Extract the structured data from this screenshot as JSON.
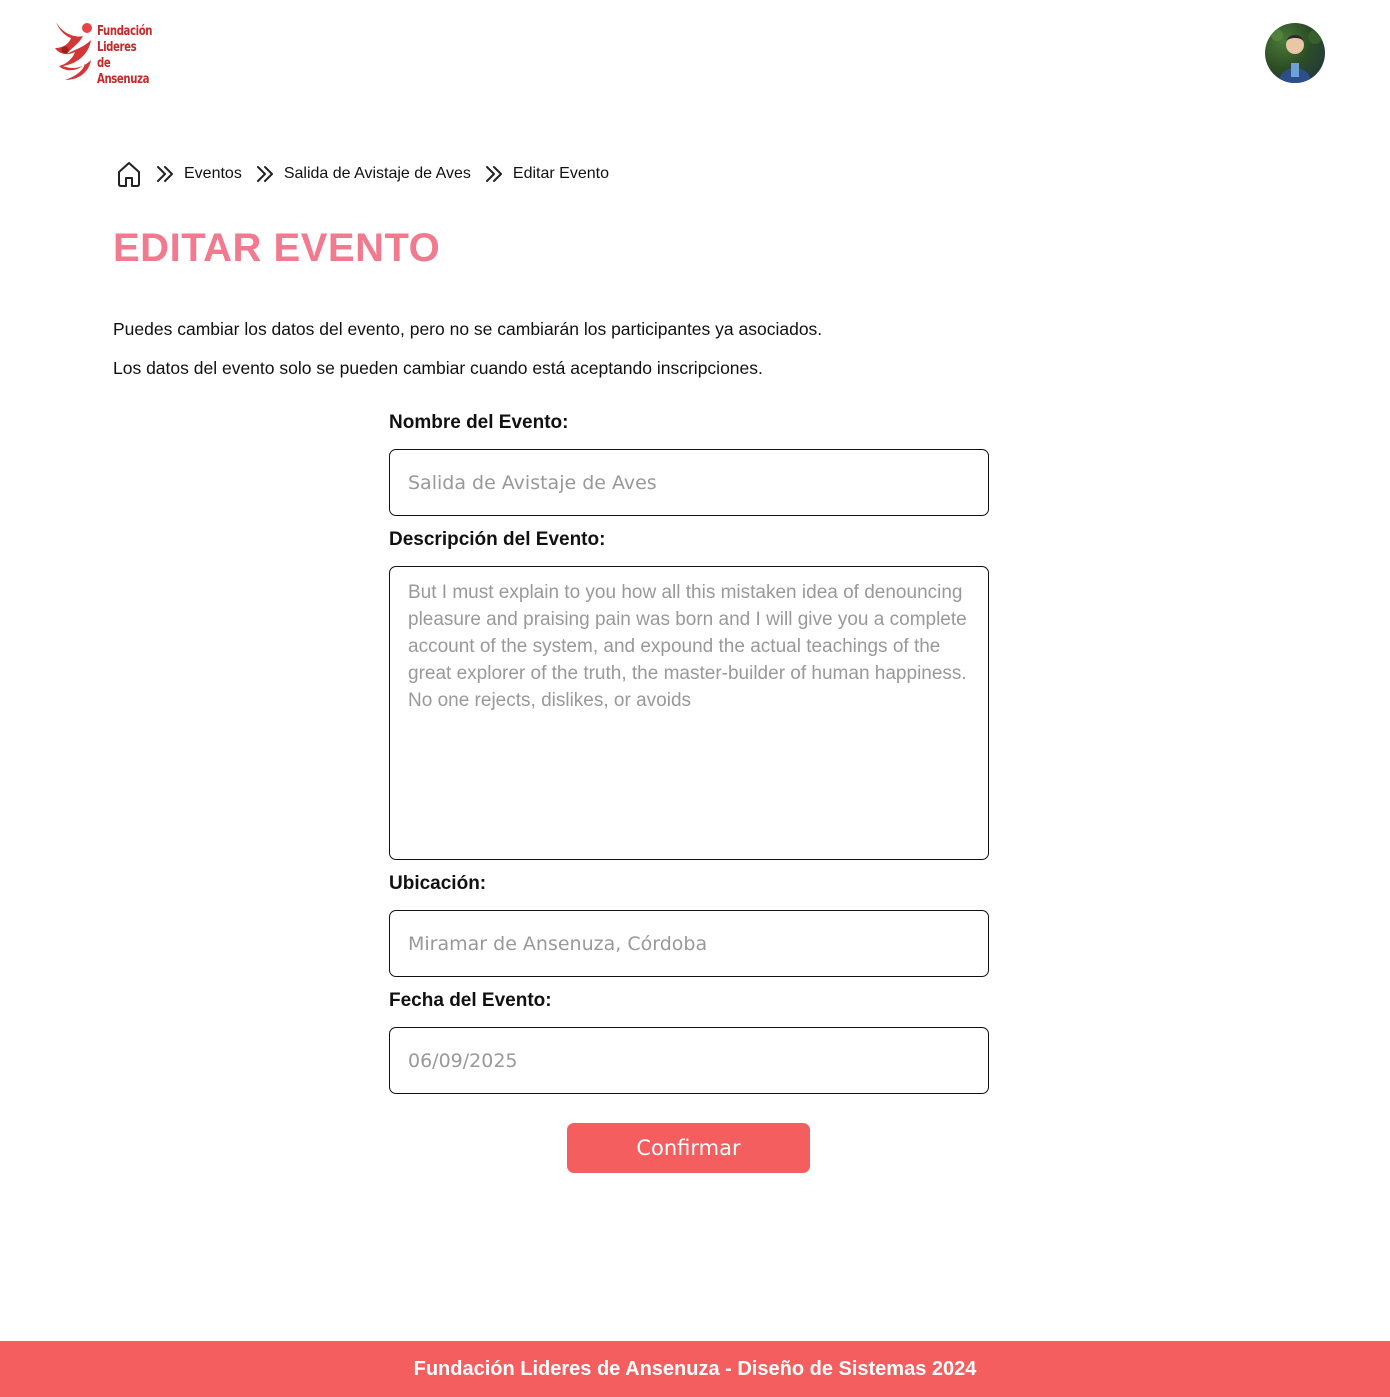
{
  "header": {
    "logo_lines": [
      "Fundación",
      "Lideres de",
      "Ansenuza"
    ],
    "logo_icon": "foundation-logo-icon",
    "avatar_icon": "user-avatar"
  },
  "breadcrumb": {
    "home_icon": "home-icon",
    "separator_icon": "chevrons-right-icon",
    "items": [
      "Eventos",
      "Salida de Avistaje de Aves",
      "Editar Evento"
    ]
  },
  "page": {
    "title": "EDITAR EVENTO",
    "intro_1": "Puedes cambiar los datos del evento, pero no se cambiarán los participantes ya asociados.",
    "intro_2": "Los datos del evento solo se pueden cambiar cuando está aceptando inscripciones."
  },
  "form": {
    "name_label": "Nombre del Evento:",
    "name_placeholder": "Salida de Avistaje de Aves",
    "description_label": "Descripción del Evento:",
    "description_placeholder": "But I must explain to you how all this mistaken idea of denouncing pleasure and praising pain was born and I will give you a complete account of the system, and expound the actual teachings of the great explorer of the truth, the master-builder of human happiness. No one rejects, dislikes, or avoids",
    "location_label": "Ubicación:",
    "location_placeholder": "Miramar de Ansenuza, Córdoba",
    "date_label": "Fecha del Evento:",
    "date_placeholder": "06/09/2025",
    "confirm_label": "Confirmar"
  },
  "footer": {
    "text": "Fundación Lideres de Ansenuza - Diseño de Sistemas 2024"
  },
  "colors": {
    "accent": "#f55e5e",
    "title_pink": "#f27a8e",
    "logo_red": "#c62a2a"
  }
}
